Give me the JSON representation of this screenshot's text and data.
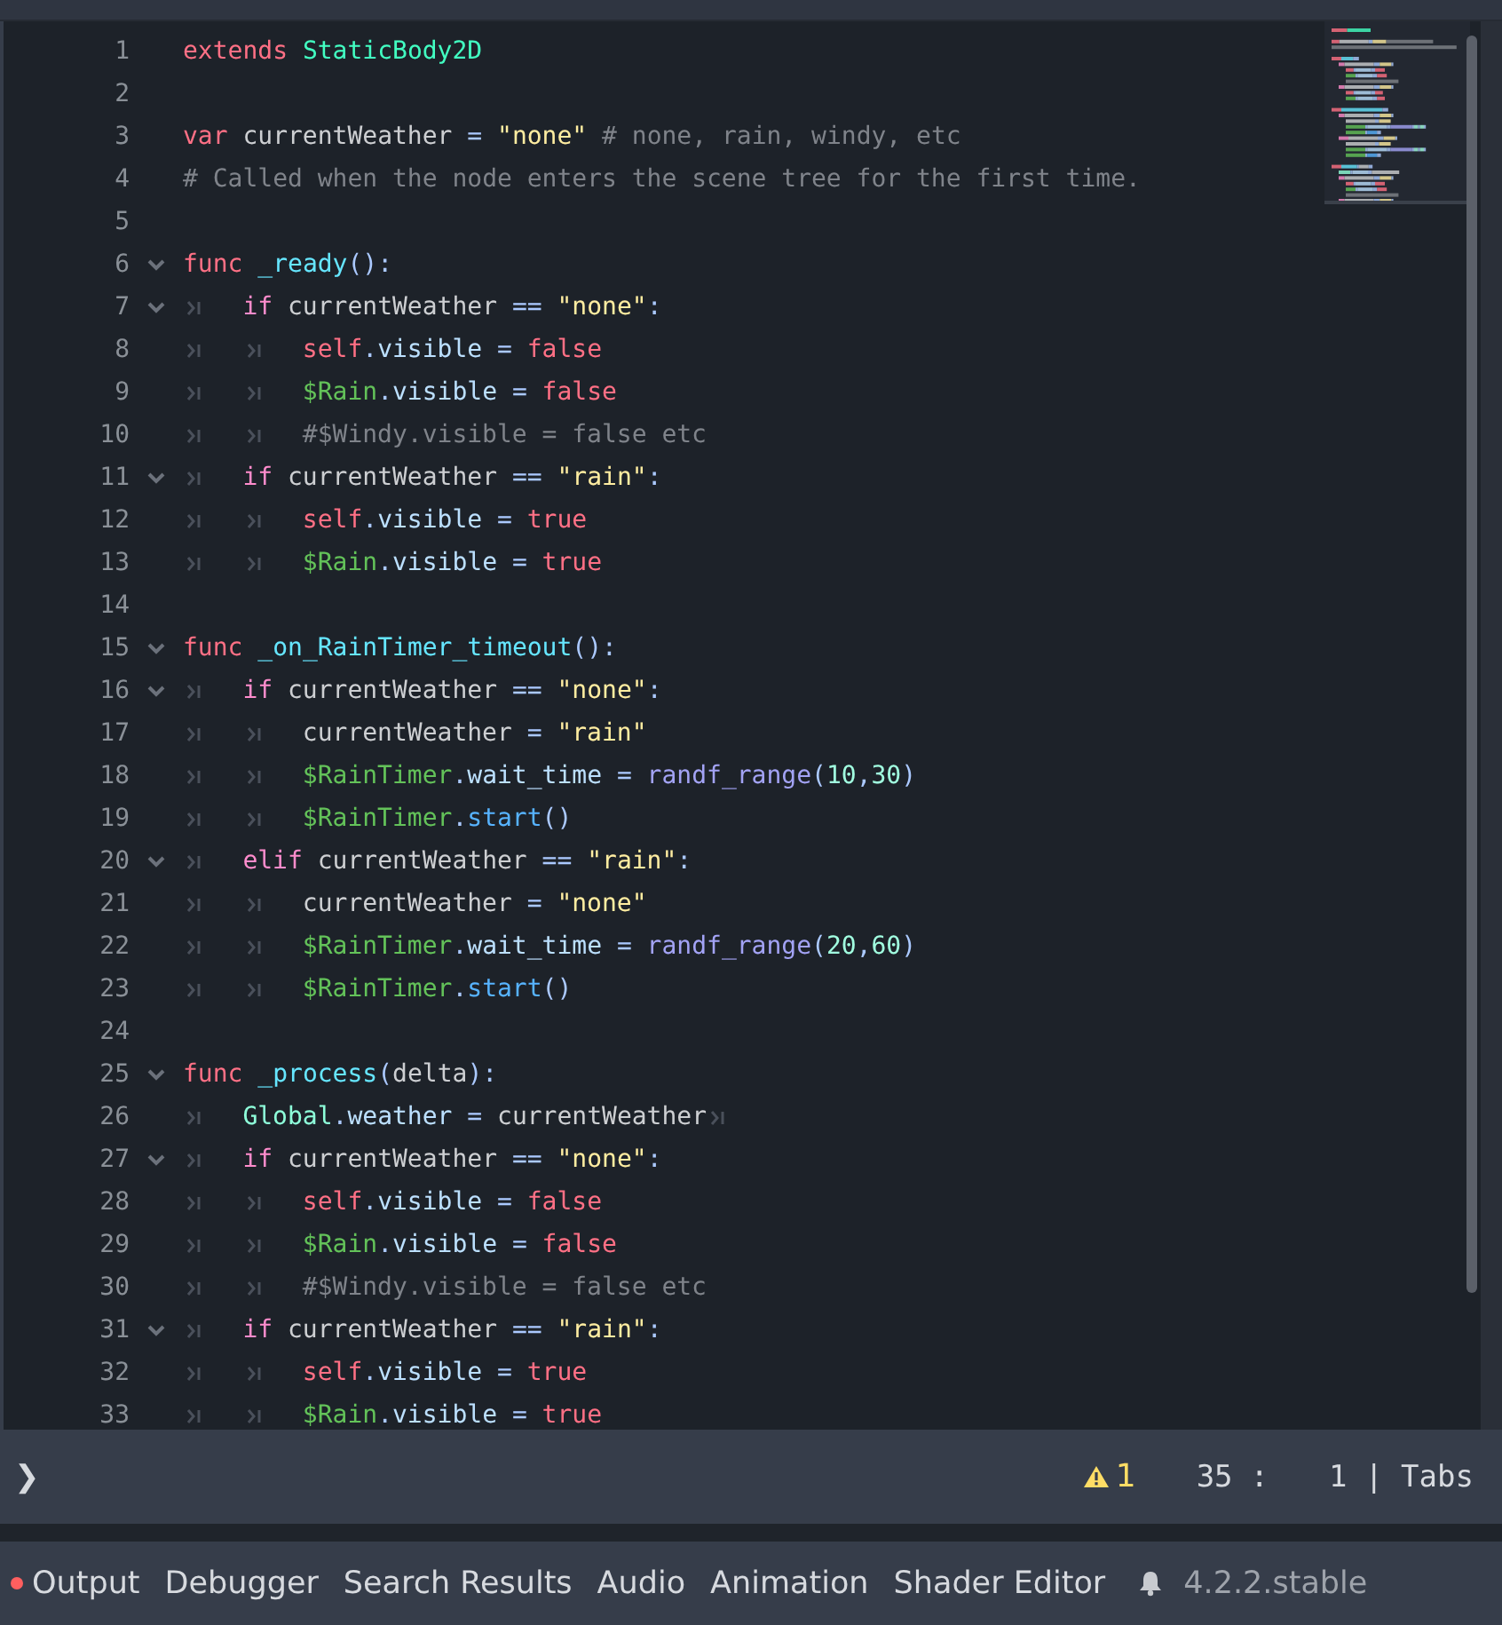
{
  "editor": {
    "lines": [
      {
        "number": "1",
        "fold": false,
        "tokens": [
          {
            "kind": "kw",
            "text": "extends "
          },
          {
            "kind": "type",
            "text": "StaticBody2D"
          }
        ]
      },
      {
        "number": "2",
        "fold": false
      },
      {
        "number": "3",
        "fold": false,
        "tokens": [
          {
            "kind": "kw",
            "text": "var "
          },
          {
            "kind": "plain",
            "text": "currentWeather "
          },
          {
            "kind": "op",
            "text": "= "
          },
          {
            "kind": "str",
            "text": "\"none\" "
          },
          {
            "kind": "comment",
            "text": "# none, rain, windy, etc"
          }
        ]
      },
      {
        "number": "4",
        "fold": false,
        "tokens": [
          {
            "kind": "comment",
            "text": "# Called when the node enters the scene tree for the first time."
          }
        ]
      },
      {
        "number": "5",
        "fold": false
      },
      {
        "number": "6",
        "fold": true,
        "tokens": [
          {
            "kind": "kw",
            "text": "func "
          },
          {
            "kind": "fn",
            "text": "_ready"
          },
          {
            "kind": "op",
            "text": "():"
          }
        ]
      },
      {
        "number": "7",
        "fold": true,
        "tokens": [
          {
            "kind": "tab"
          },
          {
            "kind": "ctl",
            "text": "if "
          },
          {
            "kind": "plain",
            "text": "currentWeather "
          },
          {
            "kind": "op",
            "text": "== "
          },
          {
            "kind": "str",
            "text": "\"none\""
          },
          {
            "kind": "op",
            "text": ":"
          }
        ]
      },
      {
        "number": "8",
        "fold": false,
        "tokens": [
          {
            "kind": "tab"
          },
          {
            "kind": "tab"
          },
          {
            "kind": "kw",
            "text": "self"
          },
          {
            "kind": "op",
            "text": "."
          },
          {
            "kind": "member",
            "text": "visible "
          },
          {
            "kind": "op",
            "text": "= "
          },
          {
            "kind": "kw",
            "text": "false"
          }
        ]
      },
      {
        "number": "9",
        "fold": false,
        "tokens": [
          {
            "kind": "tab"
          },
          {
            "kind": "tab"
          },
          {
            "kind": "node",
            "text": "$Rain"
          },
          {
            "kind": "op",
            "text": "."
          },
          {
            "kind": "member",
            "text": "visible "
          },
          {
            "kind": "op",
            "text": "= "
          },
          {
            "kind": "kw",
            "text": "false"
          }
        ]
      },
      {
        "number": "10",
        "fold": false,
        "tokens": [
          {
            "kind": "tab"
          },
          {
            "kind": "tab"
          },
          {
            "kind": "comment",
            "text": "#$Windy.visible = false etc"
          }
        ]
      },
      {
        "number": "11",
        "fold": true,
        "tokens": [
          {
            "kind": "tab"
          },
          {
            "kind": "ctl",
            "text": "if "
          },
          {
            "kind": "plain",
            "text": "currentWeather "
          },
          {
            "kind": "op",
            "text": "== "
          },
          {
            "kind": "str",
            "text": "\"rain\""
          },
          {
            "kind": "op",
            "text": ":"
          }
        ]
      },
      {
        "number": "12",
        "fold": false,
        "tokens": [
          {
            "kind": "tab"
          },
          {
            "kind": "tab"
          },
          {
            "kind": "kw",
            "text": "self"
          },
          {
            "kind": "op",
            "text": "."
          },
          {
            "kind": "member",
            "text": "visible "
          },
          {
            "kind": "op",
            "text": "= "
          },
          {
            "kind": "kw",
            "text": "true"
          }
        ]
      },
      {
        "number": "13",
        "fold": false,
        "tokens": [
          {
            "kind": "tab"
          },
          {
            "kind": "tab"
          },
          {
            "kind": "node",
            "text": "$Rain"
          },
          {
            "kind": "op",
            "text": "."
          },
          {
            "kind": "member",
            "text": "visible "
          },
          {
            "kind": "op",
            "text": "= "
          },
          {
            "kind": "kw",
            "text": "true"
          }
        ]
      },
      {
        "number": "14",
        "fold": false
      },
      {
        "number": "15",
        "fold": true,
        "tokens": [
          {
            "kind": "kw",
            "text": "func "
          },
          {
            "kind": "fn",
            "text": "_on_RainTimer_timeout"
          },
          {
            "kind": "op",
            "text": "():"
          }
        ]
      },
      {
        "number": "16",
        "fold": true,
        "tokens": [
          {
            "kind": "tab"
          },
          {
            "kind": "ctl",
            "text": "if "
          },
          {
            "kind": "plain",
            "text": "currentWeather "
          },
          {
            "kind": "op",
            "text": "== "
          },
          {
            "kind": "str",
            "text": "\"none\""
          },
          {
            "kind": "op",
            "text": ":"
          }
        ]
      },
      {
        "number": "17",
        "fold": false,
        "tokens": [
          {
            "kind": "tab"
          },
          {
            "kind": "tab"
          },
          {
            "kind": "plain",
            "text": "currentWeather "
          },
          {
            "kind": "op",
            "text": "= "
          },
          {
            "kind": "str",
            "text": "\"rain\""
          }
        ]
      },
      {
        "number": "18",
        "fold": false,
        "tokens": [
          {
            "kind": "tab"
          },
          {
            "kind": "tab"
          },
          {
            "kind": "node",
            "text": "$RainTimer"
          },
          {
            "kind": "op",
            "text": "."
          },
          {
            "kind": "member",
            "text": "wait_time "
          },
          {
            "kind": "op",
            "text": "= "
          },
          {
            "kind": "call",
            "text": "randf_range"
          },
          {
            "kind": "op",
            "text": "("
          },
          {
            "kind": "num",
            "text": "10"
          },
          {
            "kind": "op",
            "text": ","
          },
          {
            "kind": "num",
            "text": "30"
          },
          {
            "kind": "op",
            "text": ")"
          }
        ]
      },
      {
        "number": "19",
        "fold": false,
        "tokens": [
          {
            "kind": "tab"
          },
          {
            "kind": "tab"
          },
          {
            "kind": "node",
            "text": "$RainTimer"
          },
          {
            "kind": "op",
            "text": "."
          },
          {
            "kind": "method",
            "text": "start"
          },
          {
            "kind": "op",
            "text": "()"
          }
        ]
      },
      {
        "number": "20",
        "fold": true,
        "tokens": [
          {
            "kind": "tab"
          },
          {
            "kind": "ctl",
            "text": "elif "
          },
          {
            "kind": "plain",
            "text": "currentWeather "
          },
          {
            "kind": "op",
            "text": "== "
          },
          {
            "kind": "str",
            "text": "\"rain\""
          },
          {
            "kind": "op",
            "text": ":"
          }
        ]
      },
      {
        "number": "21",
        "fold": false,
        "tokens": [
          {
            "kind": "tab"
          },
          {
            "kind": "tab"
          },
          {
            "kind": "plain",
            "text": "currentWeather "
          },
          {
            "kind": "op",
            "text": "= "
          },
          {
            "kind": "str",
            "text": "\"none\""
          }
        ]
      },
      {
        "number": "22",
        "fold": false,
        "tokens": [
          {
            "kind": "tab"
          },
          {
            "kind": "tab"
          },
          {
            "kind": "node",
            "text": "$RainTimer"
          },
          {
            "kind": "op",
            "text": "."
          },
          {
            "kind": "member",
            "text": "wait_time "
          },
          {
            "kind": "op",
            "text": "= "
          },
          {
            "kind": "call",
            "text": "randf_range"
          },
          {
            "kind": "op",
            "text": "("
          },
          {
            "kind": "num",
            "text": "20"
          },
          {
            "kind": "op",
            "text": ","
          },
          {
            "kind": "num",
            "text": "60"
          },
          {
            "kind": "op",
            "text": ")"
          }
        ]
      },
      {
        "number": "23",
        "fold": false,
        "tokens": [
          {
            "kind": "tab"
          },
          {
            "kind": "tab"
          },
          {
            "kind": "node",
            "text": "$RainTimer"
          },
          {
            "kind": "op",
            "text": "."
          },
          {
            "kind": "method",
            "text": "start"
          },
          {
            "kind": "op",
            "text": "()"
          }
        ]
      },
      {
        "number": "24",
        "fold": false
      },
      {
        "number": "25",
        "fold": true,
        "tokens": [
          {
            "kind": "kw",
            "text": "func "
          },
          {
            "kind": "fn",
            "text": "_process"
          },
          {
            "kind": "op",
            "text": "("
          },
          {
            "kind": "plain",
            "text": "delta"
          },
          {
            "kind": "op",
            "text": "):"
          }
        ]
      },
      {
        "number": "26",
        "fold": false,
        "tokens": [
          {
            "kind": "tab"
          },
          {
            "kind": "global",
            "text": "Global"
          },
          {
            "kind": "op",
            "text": "."
          },
          {
            "kind": "member",
            "text": "weather "
          },
          {
            "kind": "op",
            "text": "= "
          },
          {
            "kind": "plain",
            "text": "currentWeather"
          },
          {
            "kind": "tab"
          }
        ]
      },
      {
        "number": "27",
        "fold": true,
        "tokens": [
          {
            "kind": "tab"
          },
          {
            "kind": "ctl",
            "text": "if "
          },
          {
            "kind": "plain",
            "text": "currentWeather "
          },
          {
            "kind": "op",
            "text": "== "
          },
          {
            "kind": "str",
            "text": "\"none\""
          },
          {
            "kind": "op",
            "text": ":"
          }
        ]
      },
      {
        "number": "28",
        "fold": false,
        "tokens": [
          {
            "kind": "tab"
          },
          {
            "kind": "tab"
          },
          {
            "kind": "kw",
            "text": "self"
          },
          {
            "kind": "op",
            "text": "."
          },
          {
            "kind": "member",
            "text": "visible "
          },
          {
            "kind": "op",
            "text": "= "
          },
          {
            "kind": "kw",
            "text": "false"
          }
        ]
      },
      {
        "number": "29",
        "fold": false,
        "tokens": [
          {
            "kind": "tab"
          },
          {
            "kind": "tab"
          },
          {
            "kind": "node",
            "text": "$Rain"
          },
          {
            "kind": "op",
            "text": "."
          },
          {
            "kind": "member",
            "text": "visible "
          },
          {
            "kind": "op",
            "text": "= "
          },
          {
            "kind": "kw",
            "text": "false"
          }
        ]
      },
      {
        "number": "30",
        "fold": false,
        "tokens": [
          {
            "kind": "tab"
          },
          {
            "kind": "tab"
          },
          {
            "kind": "comment",
            "text": "#$Windy.visible = false etc"
          }
        ]
      },
      {
        "number": "31",
        "fold": true,
        "tokens": [
          {
            "kind": "tab"
          },
          {
            "kind": "ctl",
            "text": "if "
          },
          {
            "kind": "plain",
            "text": "currentWeather "
          },
          {
            "kind": "op",
            "text": "== "
          },
          {
            "kind": "str",
            "text": "\"rain\""
          },
          {
            "kind": "op",
            "text": ":"
          }
        ]
      },
      {
        "number": "32",
        "fold": false,
        "tokens": [
          {
            "kind": "tab"
          },
          {
            "kind": "tab"
          },
          {
            "kind": "kw",
            "text": "self"
          },
          {
            "kind": "op",
            "text": "."
          },
          {
            "kind": "member",
            "text": "visible "
          },
          {
            "kind": "op",
            "text": "= "
          },
          {
            "kind": "kw",
            "text": "true"
          }
        ]
      },
      {
        "number": "33",
        "fold": false,
        "tokens": [
          {
            "kind": "tab"
          },
          {
            "kind": "tab"
          },
          {
            "kind": "node",
            "text": "$Rain"
          },
          {
            "kind": "op",
            "text": "."
          },
          {
            "kind": "member",
            "text": "visible "
          },
          {
            "kind": "op",
            "text": "= "
          },
          {
            "kind": "kw",
            "text": "true"
          }
        ]
      }
    ]
  },
  "status_bar": {
    "toggle": "❯",
    "warnings": "1",
    "line": "35",
    "separator": ":",
    "column": "1",
    "divider": "|",
    "indent": "Tabs"
  },
  "bottom_tabs": [
    {
      "label": "Output",
      "alert": true
    },
    {
      "label": "Debugger",
      "alert": false
    },
    {
      "label": "Search Results",
      "alert": false
    },
    {
      "label": "Audio",
      "alert": false
    },
    {
      "label": "Animation",
      "alert": false
    },
    {
      "label": "Shader Editor",
      "alert": false
    }
  ],
  "version": "4.2.2.stable"
}
